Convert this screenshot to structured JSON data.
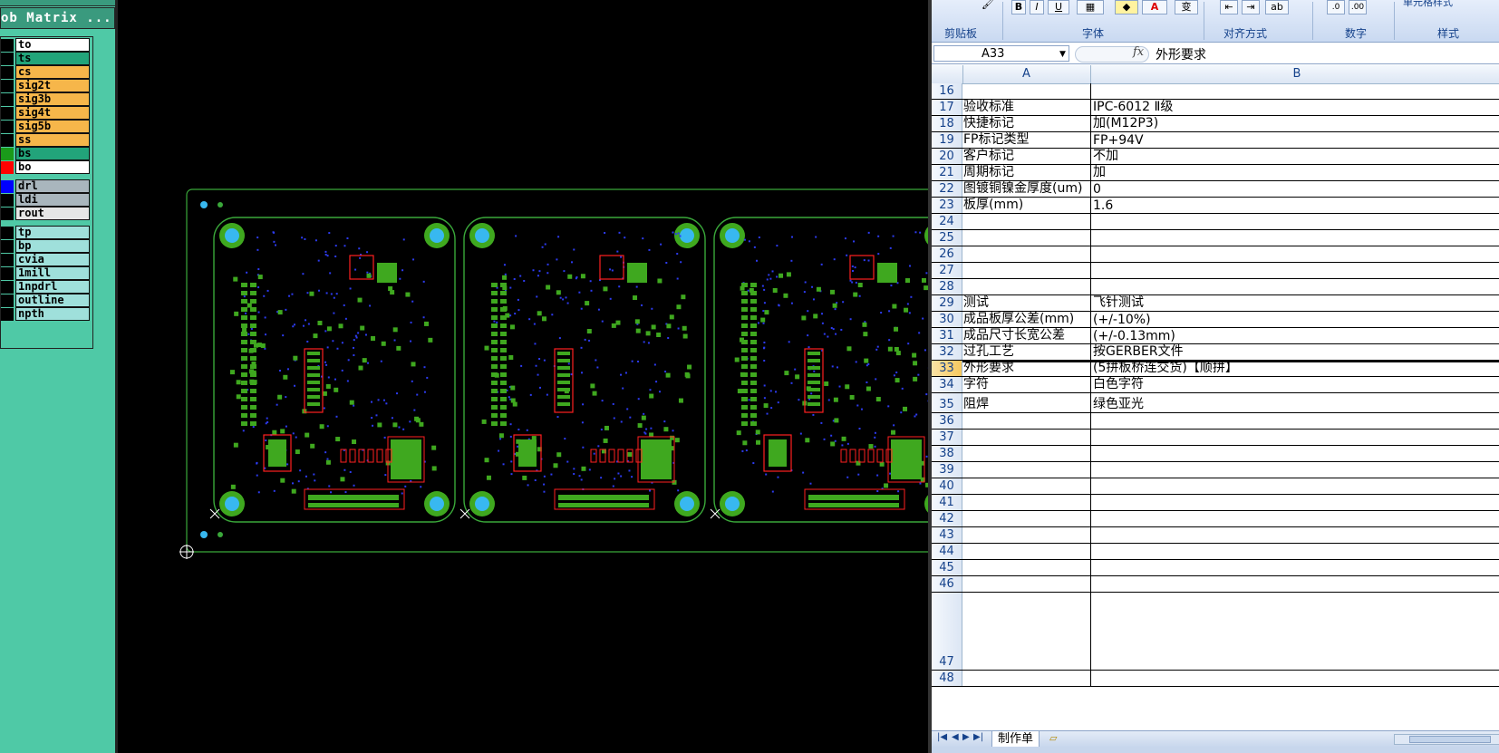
{
  "cam": {
    "title": "ob Matrix ...",
    "layers": [
      {
        "name": "to",
        "color": "#ffffff",
        "swatch": "#000000"
      },
      {
        "name": "ts",
        "color": "#22a47a",
        "swatch": "#000000"
      },
      {
        "name": "cs",
        "color": "#f6b64a",
        "swatch": "#000000"
      },
      {
        "name": "sig2t",
        "color": "#f6b64a",
        "swatch": "#000000"
      },
      {
        "name": "sig3b",
        "color": "#f6b64a",
        "swatch": "#000000"
      },
      {
        "name": "sig4t",
        "color": "#f6b64a",
        "swatch": "#000000"
      },
      {
        "name": "sig5b",
        "color": "#f6b64a",
        "swatch": "#000000"
      },
      {
        "name": "ss",
        "color": "#f6b64a",
        "swatch": "#000000"
      },
      {
        "name": "bs",
        "color": "#22a47a",
        "swatch": "#1a9a1a"
      },
      {
        "name": "bo",
        "color": "#ffffff",
        "swatch": "#ff0000"
      },
      {
        "name": "drl",
        "color": "#a9b6bd",
        "swatch": "#0000ff"
      },
      {
        "name": "ldi",
        "color": "#a9b6bd",
        "swatch": "#000000"
      },
      {
        "name": "rout",
        "color": "#e6e6e6",
        "swatch": "#000000"
      },
      {
        "name": "tp",
        "color": "#9fe0db",
        "swatch": "#000000"
      },
      {
        "name": "bp",
        "color": "#9fe0db",
        "swatch": "#000000"
      },
      {
        "name": "cvia",
        "color": "#9fe0db",
        "swatch": "#000000"
      },
      {
        "name": "1mill",
        "color": "#9fe0db",
        "swatch": "#000000"
      },
      {
        "name": "1npdrl",
        "color": "#9fe0db",
        "swatch": "#000000"
      },
      {
        "name": "outline",
        "color": "#9fe0db",
        "swatch": "#000000"
      },
      {
        "name": "npth",
        "color": "#9fe0db",
        "swatch": "#000000"
      }
    ]
  },
  "excel": {
    "ribbon": {
      "groups": [
        "剪贴板",
        "字体",
        "对齐方式",
        "数字",
        "样式"
      ],
      "style_button": "单元格样式"
    },
    "name_box": "A33",
    "fx": "fx",
    "formula": "外形要求",
    "columns": [
      "A",
      "B"
    ],
    "rows": [
      {
        "n": "16",
        "a": "",
        "b": ""
      },
      {
        "n": "17",
        "a": "验收标准",
        "b": "IPC-6012 Ⅱ级"
      },
      {
        "n": "18",
        "a": "快捷标记",
        "b": "加(M12P3)"
      },
      {
        "n": "19",
        "a": "FP标记类型",
        "b": "FP+94V"
      },
      {
        "n": "20",
        "a": "客户标记",
        "b": "不加"
      },
      {
        "n": "21",
        "a": "周期标记",
        "b": "加"
      },
      {
        "n": "22",
        "a": "图镀铜镍金厚度(um)",
        "b": "0"
      },
      {
        "n": "23",
        "a": "板厚(mm)",
        "b": "1.6"
      },
      {
        "n": "24",
        "a": "",
        "b": ""
      },
      {
        "n": "25",
        "a": "",
        "b": ""
      },
      {
        "n": "26",
        "a": "",
        "b": ""
      },
      {
        "n": "27",
        "a": "",
        "b": ""
      },
      {
        "n": "28",
        "a": "",
        "b": ""
      },
      {
        "n": "29",
        "a": "测试",
        "b": "飞针测试"
      },
      {
        "n": "30",
        "a": "成品板厚公差(mm)",
        "b": "(+/-10%)"
      },
      {
        "n": "31",
        "a": "成品尺寸长宽公差",
        "b": "(+/-0.13mm)"
      },
      {
        "n": "32",
        "a": "过孔工艺",
        "b": "按GERBER文件"
      },
      {
        "n": "33",
        "a": "外形要求",
        "b": "(5拼板桥连交货)【顺拼】"
      },
      {
        "n": "34",
        "a": "字符",
        "b": "白色字符"
      },
      {
        "n": "35",
        "a": "阻焊",
        "b": "绿色亚光"
      },
      {
        "n": "36",
        "a": "",
        "b": ""
      },
      {
        "n": "37",
        "a": "",
        "b": ""
      },
      {
        "n": "38",
        "a": "",
        "b": ""
      },
      {
        "n": "39",
        "a": "",
        "b": ""
      },
      {
        "n": "40",
        "a": "",
        "b": ""
      },
      {
        "n": "41",
        "a": "",
        "b": ""
      },
      {
        "n": "42",
        "a": "",
        "b": ""
      },
      {
        "n": "43",
        "a": "",
        "b": ""
      },
      {
        "n": "44",
        "a": "",
        "b": ""
      },
      {
        "n": "45",
        "a": "",
        "b": ""
      },
      {
        "n": "46",
        "a": "",
        "b": ""
      },
      {
        "n": "47",
        "a": "",
        "b": ""
      },
      {
        "n": "48",
        "a": "",
        "b": ""
      }
    ],
    "sheet_tab": "制作单"
  }
}
